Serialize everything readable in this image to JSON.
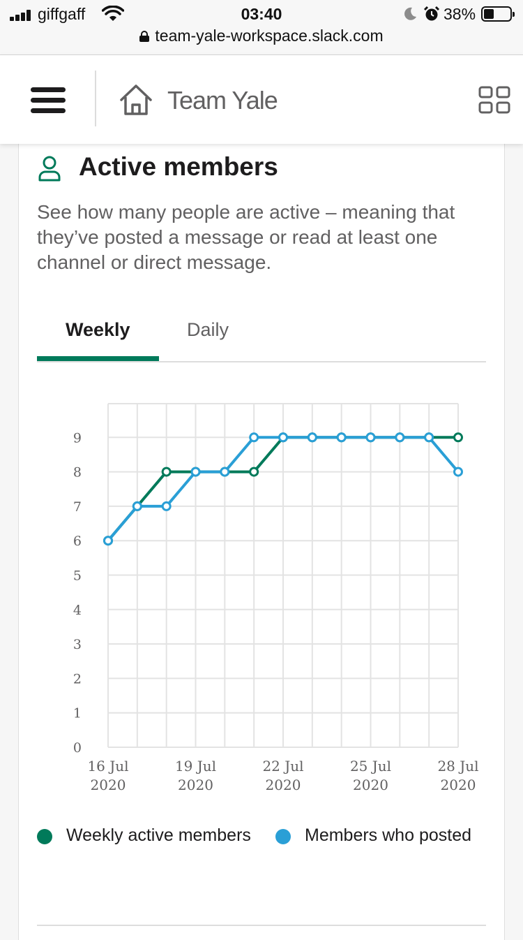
{
  "status_bar": {
    "carrier": "giffgaff",
    "time": "03:40",
    "battery": "38%",
    "url": "team-yale-workspace.slack.com"
  },
  "header": {
    "workspace_name": "Team Yale",
    "menu_icon": "hamburger-menu-icon",
    "home_icon": "home-icon",
    "apps_icon": "grid-icon"
  },
  "card": {
    "title": "Active members",
    "description": "See how many people are active – meaning that they’ve posted a message or read at least one channel or direct message.",
    "tabs": [
      {
        "label": "Weekly",
        "active": true
      },
      {
        "label": "Daily",
        "active": false
      }
    ]
  },
  "colors": {
    "green": "#007a5a",
    "blue": "#2a9fd6"
  },
  "chart_data": {
    "type": "line",
    "x": [
      "16 Jul 2020",
      "17 Jul 2020",
      "18 Jul 2020",
      "19 Jul 2020",
      "20 Jul 2020",
      "21 Jul 2020",
      "22 Jul 2020",
      "23 Jul 2020",
      "24 Jul 2020",
      "25 Jul 2020",
      "26 Jul 2020",
      "27 Jul 2020",
      "28 Jul 2020"
    ],
    "x_tick_labels": [
      {
        "index": 0,
        "line1": "16 Jul",
        "line2": "2020"
      },
      {
        "index": 3,
        "line1": "19 Jul",
        "line2": "2020"
      },
      {
        "index": 6,
        "line1": "22 Jul",
        "line2": "2020"
      },
      {
        "index": 9,
        "line1": "25 Jul",
        "line2": "2020"
      },
      {
        "index": 12,
        "line1": "28 Jul",
        "line2": "2020"
      }
    ],
    "y_ticks": [
      0,
      1,
      2,
      3,
      4,
      5,
      6,
      7,
      8,
      9
    ],
    "ylim": [
      0,
      10
    ],
    "grid": true,
    "legend_position": "bottom",
    "series": [
      {
        "name": "Weekly active members",
        "color": "#007a5a",
        "values": [
          6,
          7,
          8,
          8,
          8,
          8,
          9,
          9,
          9,
          9,
          9,
          9,
          9
        ]
      },
      {
        "name": "Members who posted",
        "color": "#2a9fd6",
        "values": [
          6,
          7,
          7,
          8,
          8,
          9,
          9,
          9,
          9,
          9,
          9,
          9,
          8
        ]
      }
    ]
  }
}
